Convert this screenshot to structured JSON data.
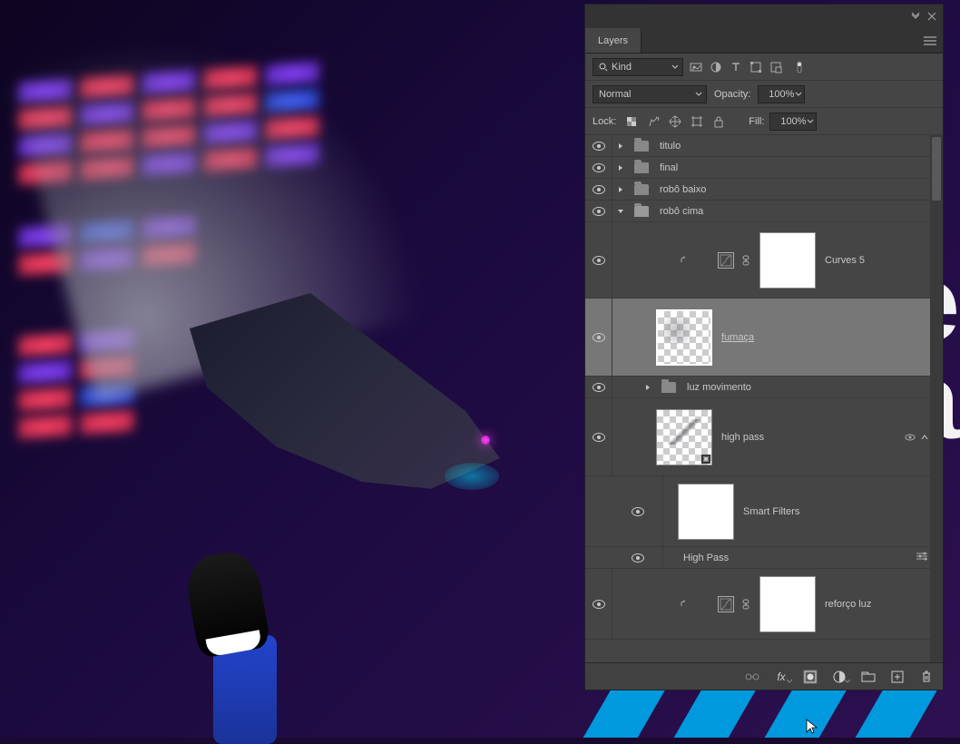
{
  "panel": {
    "tab_label": "Layers",
    "filter": {
      "mode": "Kind"
    },
    "blend": {
      "mode": "Normal",
      "opacity_label": "Opacity:",
      "opacity_value": "100%"
    },
    "lock": {
      "label": "Lock:",
      "fill_label": "Fill:",
      "fill_value": "100%"
    },
    "layers": [
      {
        "type": "group",
        "name": "titulo",
        "expanded": false,
        "visible": true
      },
      {
        "type": "group",
        "name": "final",
        "expanded": false,
        "visible": true
      },
      {
        "type": "group",
        "name": "robô baixo",
        "expanded": false,
        "visible": true
      },
      {
        "type": "group",
        "name": "robô cima",
        "expanded": true,
        "visible": true
      },
      {
        "type": "adjustment",
        "name": "Curves 5",
        "visible": true,
        "clipped": true,
        "indent": 1
      },
      {
        "type": "raster",
        "name": "fumaça",
        "visible": true,
        "selected": true,
        "indent": 1
      },
      {
        "type": "group",
        "name": "luz movimento",
        "expanded": false,
        "visible": true,
        "indent": 1
      },
      {
        "type": "smartobject",
        "name": "high pass",
        "visible": true,
        "indent": 1
      },
      {
        "type": "smartfilters",
        "name": "Smart Filters",
        "visible": true,
        "indent": 2
      },
      {
        "type": "filterentry",
        "name": "High Pass",
        "visible": true,
        "indent": 2
      },
      {
        "type": "adjustment",
        "name": "reforço luz",
        "visible": true,
        "clipped": true,
        "indent": 1
      }
    ]
  }
}
